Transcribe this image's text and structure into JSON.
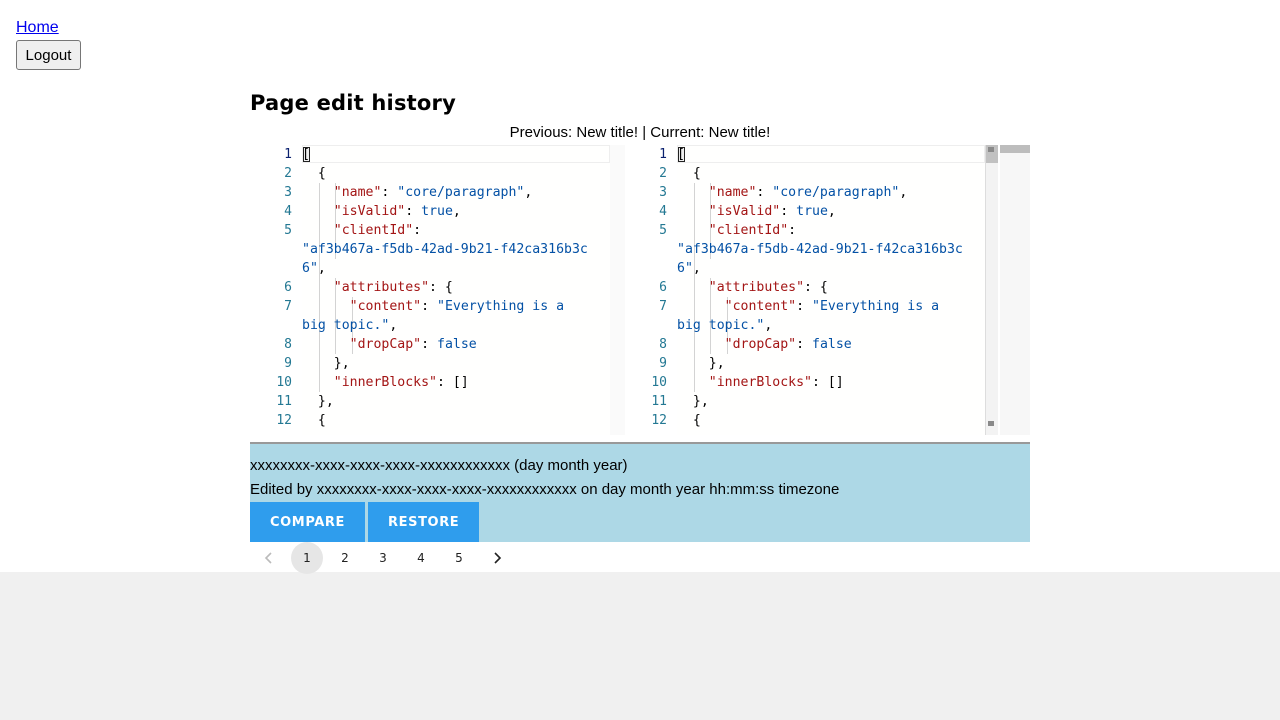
{
  "nav": {
    "home_label": "Home",
    "logout_label": "Logout"
  },
  "main": {
    "title": "Page edit history",
    "diff_caption": "Previous: New title! | Current: New title!"
  },
  "diff": {
    "line_numbers": [
      "1",
      "2",
      "3",
      "4",
      "5",
      "6",
      "7",
      "8",
      "9",
      "10",
      "11",
      "12"
    ],
    "active_line": "1"
  },
  "revision": {
    "id_line": "xxxxxxxx-xxxx-xxxx-xxxx-xxxxxxxxxxxx (day month year)",
    "edited_line": "Edited by xxxxxxxx-xxxx-xxxx-xxxx-xxxxxxxxxxxx on day month year hh:mm:ss timezone",
    "compare_label": "COMPARE",
    "restore_label": "RESTORE"
  },
  "pagination": {
    "pages": [
      "1",
      "2",
      "3",
      "4",
      "5"
    ],
    "current": "1",
    "prev_icon": "chevron-left-icon",
    "next_icon": "chevron-right-icon"
  },
  "colors": {
    "info_bg": "#add8e6",
    "button_bg": "#2f9ded",
    "json_key": "#a31515",
    "json_value": "#0451a5",
    "line_number": "#237893"
  }
}
